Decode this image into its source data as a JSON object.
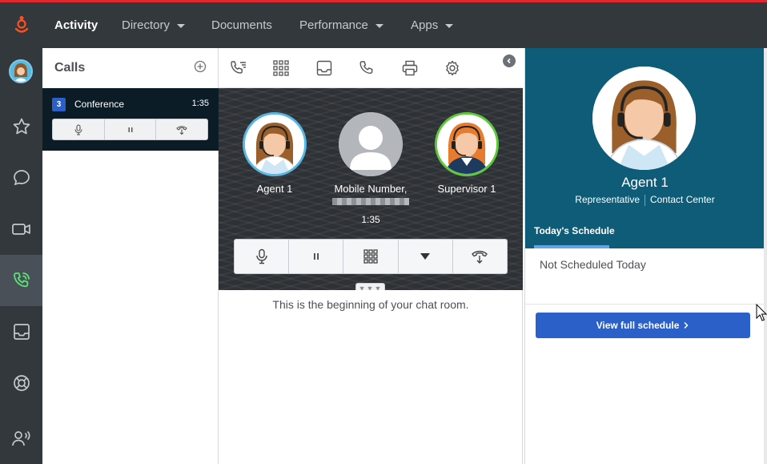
{
  "colors": {
    "accent": "#2a60c8",
    "topbar": "#33383d",
    "brand": "#e3262b",
    "profile_bg": "#0e5c78"
  },
  "topnav": {
    "logo_icon": "genesys-logo-icon",
    "items": [
      {
        "label": "Activity",
        "active": true,
        "dropdown": false
      },
      {
        "label": "Directory",
        "active": false,
        "dropdown": true
      },
      {
        "label": "Documents",
        "active": false,
        "dropdown": false
      },
      {
        "label": "Performance",
        "active": false,
        "dropdown": true
      },
      {
        "label": "Apps",
        "active": false,
        "dropdown": true
      }
    ]
  },
  "rail": {
    "items": [
      "avatar",
      "star-icon",
      "chat-bubble-icon",
      "video-icon",
      "phone-active-icon",
      "inbox-icon",
      "lifebuoy-icon",
      "user-voice-icon"
    ],
    "active": "phone-active-icon"
  },
  "calls_panel": {
    "title": "Calls",
    "conference": {
      "count": "3",
      "label": "Conference",
      "duration": "1:35"
    }
  },
  "stage": {
    "participants": [
      {
        "name": "Agent 1",
        "sub": ""
      },
      {
        "name": "Mobile Number,",
        "sub": "redacted"
      },
      {
        "name": "Supervisor 1",
        "sub": ""
      }
    ],
    "duration": "1:35",
    "handle": "▼▼▼"
  },
  "chat": {
    "message": "This is the beginning of your chat room."
  },
  "profile": {
    "name": "Agent 1",
    "role": "Representative",
    "department": "Contact Center",
    "tab": "Today's Schedule",
    "schedule_status": "Not Scheduled Today",
    "view_button": "View full schedule"
  }
}
